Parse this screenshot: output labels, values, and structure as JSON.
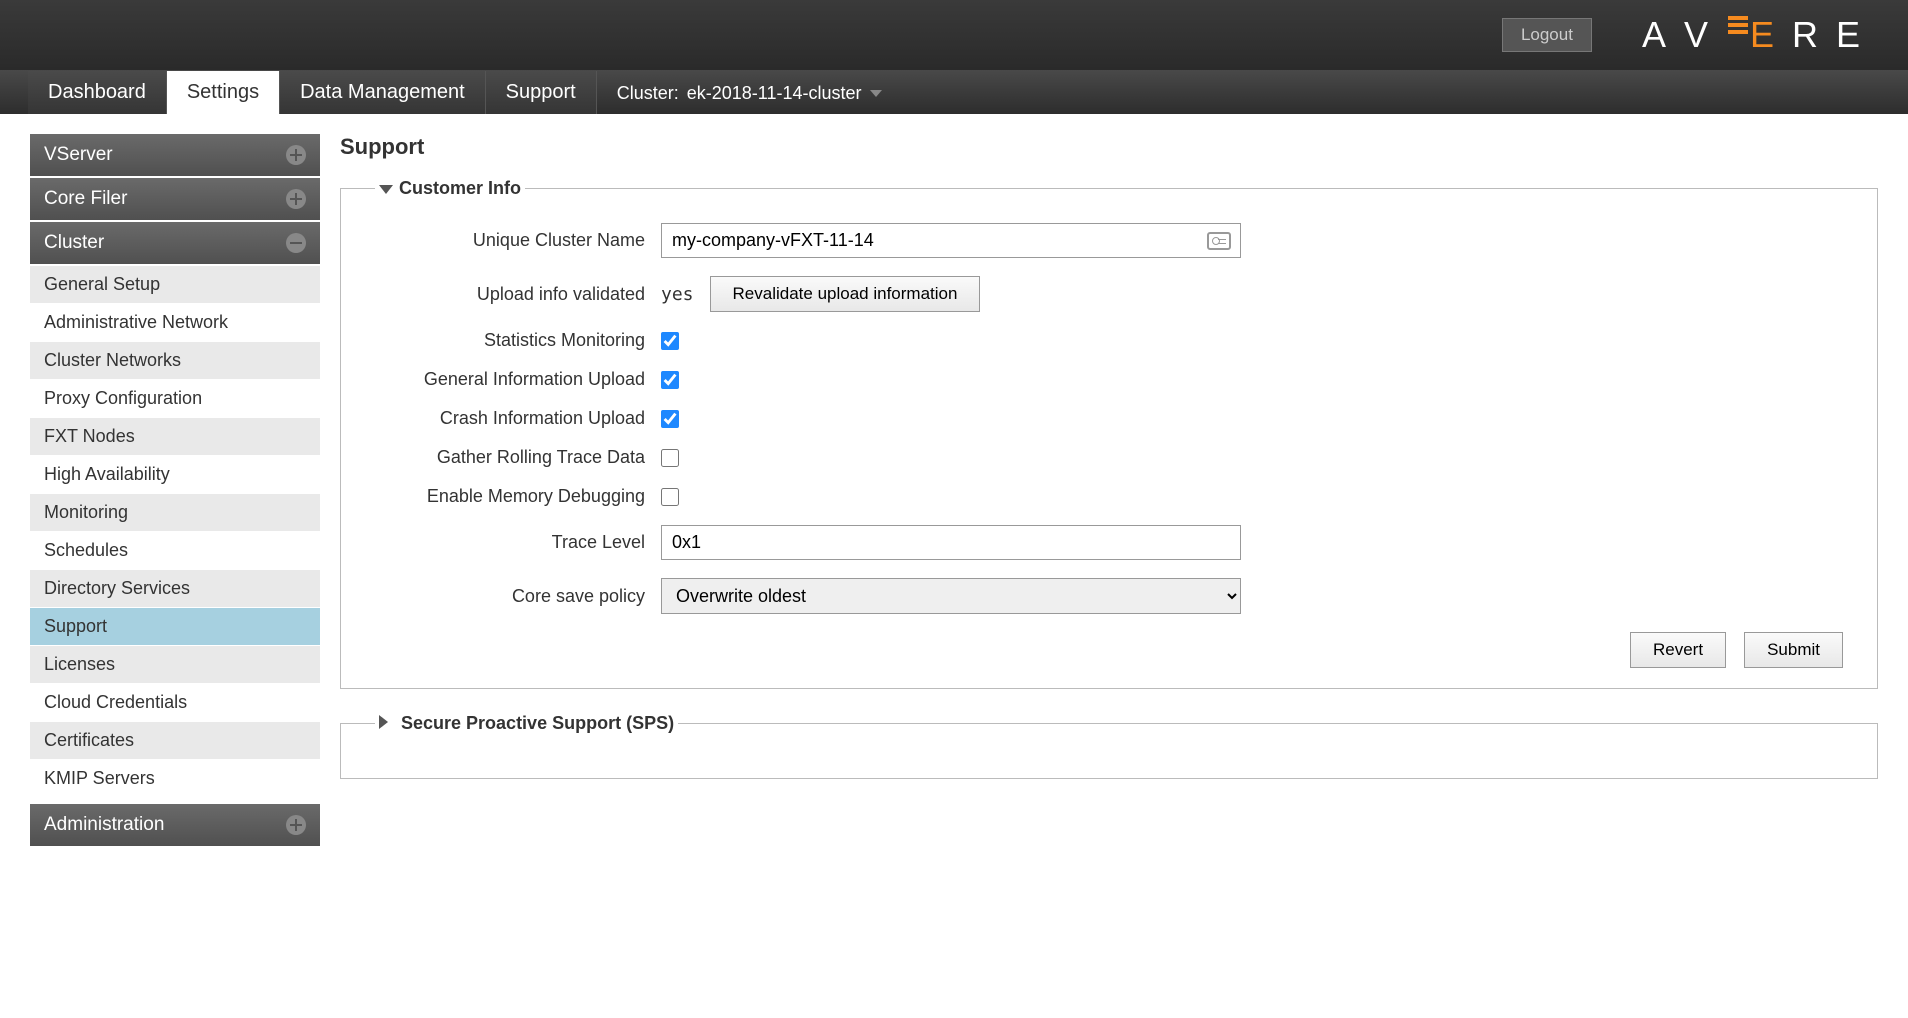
{
  "topbar": {
    "logout": "Logout"
  },
  "tabs": {
    "items": [
      {
        "label": "Dashboard"
      },
      {
        "label": "Settings"
      },
      {
        "label": "Data Management"
      },
      {
        "label": "Support"
      }
    ],
    "cluster_prefix": "Cluster: ",
    "cluster_name": "ek-2018-11-14-cluster"
  },
  "sidebar": {
    "sections": [
      {
        "title": "VServer",
        "expanded": false
      },
      {
        "title": "Core Filer",
        "expanded": false
      },
      {
        "title": "Cluster",
        "expanded": true,
        "items": [
          "General Setup",
          "Administrative Network",
          "Cluster Networks",
          "Proxy Configuration",
          "FXT Nodes",
          "High Availability",
          "Monitoring",
          "Schedules",
          "Directory Services",
          "Support",
          "Licenses",
          "Cloud Credentials",
          "Certificates",
          "KMIP Servers"
        ]
      },
      {
        "title": "Administration",
        "expanded": false
      }
    ]
  },
  "page": {
    "title": "Support",
    "fieldset1_legend": "Customer Info",
    "fieldset2_legend": "Secure Proactive Support (SPS)"
  },
  "form": {
    "unique_cluster_name_label": "Unique Cluster Name",
    "unique_cluster_name_value": "my-company-vFXT-11-14",
    "upload_validated_label": "Upload info validated",
    "upload_validated_value": "yes",
    "revalidate_button": "Revalidate upload information",
    "stats_monitoring_label": "Statistics Monitoring",
    "stats_monitoring_checked": true,
    "general_upload_label": "General Information Upload",
    "general_upload_checked": true,
    "crash_upload_label": "Crash Information Upload",
    "crash_upload_checked": true,
    "rolling_trace_label": "Gather Rolling Trace Data",
    "rolling_trace_checked": false,
    "mem_debug_label": "Enable Memory Debugging",
    "mem_debug_checked": false,
    "trace_level_label": "Trace Level",
    "trace_level_value": "0x1",
    "core_save_label": "Core save policy",
    "core_save_value": "Overwrite oldest",
    "revert_button": "Revert",
    "submit_button": "Submit"
  }
}
